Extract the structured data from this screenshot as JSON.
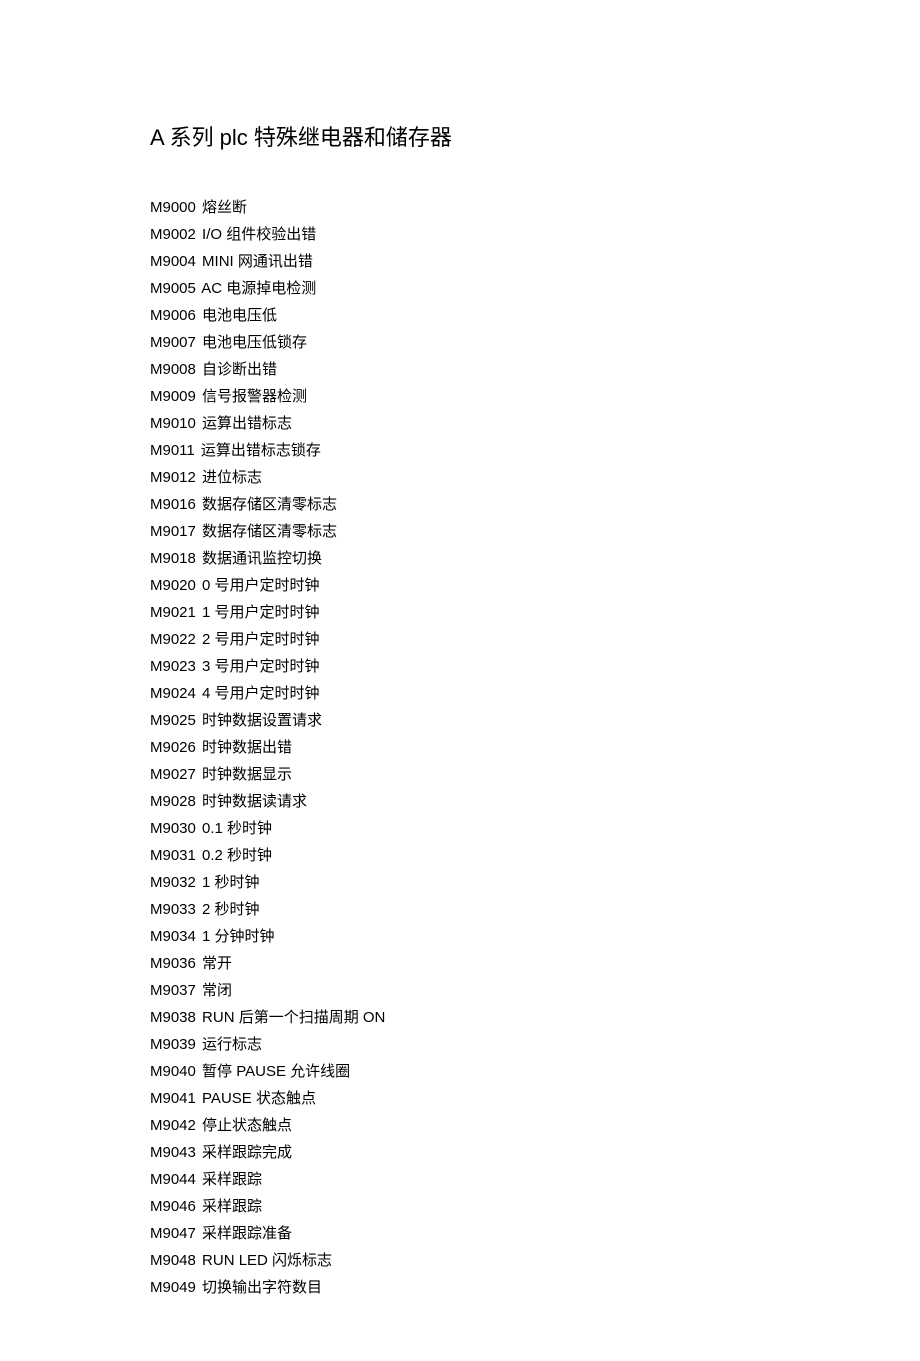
{
  "title": "A 系列 plc 特殊继电器和储存器",
  "items": [
    {
      "code": "M9000",
      "desc": "熔丝断"
    },
    {
      "code": "M9002",
      "desc": "I/O 组件校验出错"
    },
    {
      "code": "M9004",
      "desc": "MINI 网通讯出错"
    },
    {
      "code": "M9005",
      "desc": "AC 电源掉电检测"
    },
    {
      "code": "M9006",
      "desc": "电池电压低"
    },
    {
      "code": "M9007",
      "desc": "电池电压低锁存"
    },
    {
      "code": "M9008",
      "desc": "自诊断出错"
    },
    {
      "code": "M9009",
      "desc": "信号报警器检测"
    },
    {
      "code": "M9010",
      "desc": "运算出错标志"
    },
    {
      "code": "M9011",
      "desc": "运算出错标志锁存"
    },
    {
      "code": "M9012",
      "desc": "进位标志"
    },
    {
      "code": "M9016",
      "desc": "数据存储区清零标志"
    },
    {
      "code": "M9017",
      "desc": "数据存储区清零标志"
    },
    {
      "code": "M9018",
      "desc": "数据通讯监控切换"
    },
    {
      "code": "M9020",
      "desc": "0 号用户定时时钟"
    },
    {
      "code": "M9021",
      "desc": "1 号用户定时时钟"
    },
    {
      "code": "M9022",
      "desc": "2 号用户定时时钟"
    },
    {
      "code": "M9023",
      "desc": "3 号用户定时时钟"
    },
    {
      "code": "M9024",
      "desc": "4 号用户定时时钟"
    },
    {
      "code": "M9025",
      "desc": "时钟数据设置请求"
    },
    {
      "code": "M9026",
      "desc": "时钟数据出错"
    },
    {
      "code": "M9027",
      "desc": "时钟数据显示"
    },
    {
      "code": "M9028",
      "desc": "时钟数据读请求"
    },
    {
      "code": "M9030",
      "desc": "0.1 秒时钟"
    },
    {
      "code": "M9031",
      "desc": "0.2 秒时钟"
    },
    {
      "code": "M9032",
      "desc": "1 秒时钟"
    },
    {
      "code": "M9033",
      "desc": "2 秒时钟"
    },
    {
      "code": "M9034",
      "desc": "1 分钟时钟"
    },
    {
      "code": "M9036",
      "desc": "常开"
    },
    {
      "code": "M9037",
      "desc": "常闭"
    },
    {
      "code": "M9038",
      "desc": "RUN 后第一个扫描周期 ON"
    },
    {
      "code": "M9039",
      "desc": "运行标志"
    },
    {
      "code": "M9040",
      "desc": "暂停 PAUSE 允许线圈"
    },
    {
      "code": "M9041",
      "desc": "PAUSE 状态触点"
    },
    {
      "code": "M9042",
      "desc": "停止状态触点"
    },
    {
      "code": "M9043",
      "desc": "采样跟踪完成"
    },
    {
      "code": "M9044",
      "desc": "采样跟踪"
    },
    {
      "code": "M9046",
      "desc": "采样跟踪"
    },
    {
      "code": "M9047",
      "desc": "采样跟踪准备"
    },
    {
      "code": "M9048",
      "desc": "RUN LED 闪烁标志"
    },
    {
      "code": "M9049",
      "desc": "切换输出字符数目"
    }
  ]
}
